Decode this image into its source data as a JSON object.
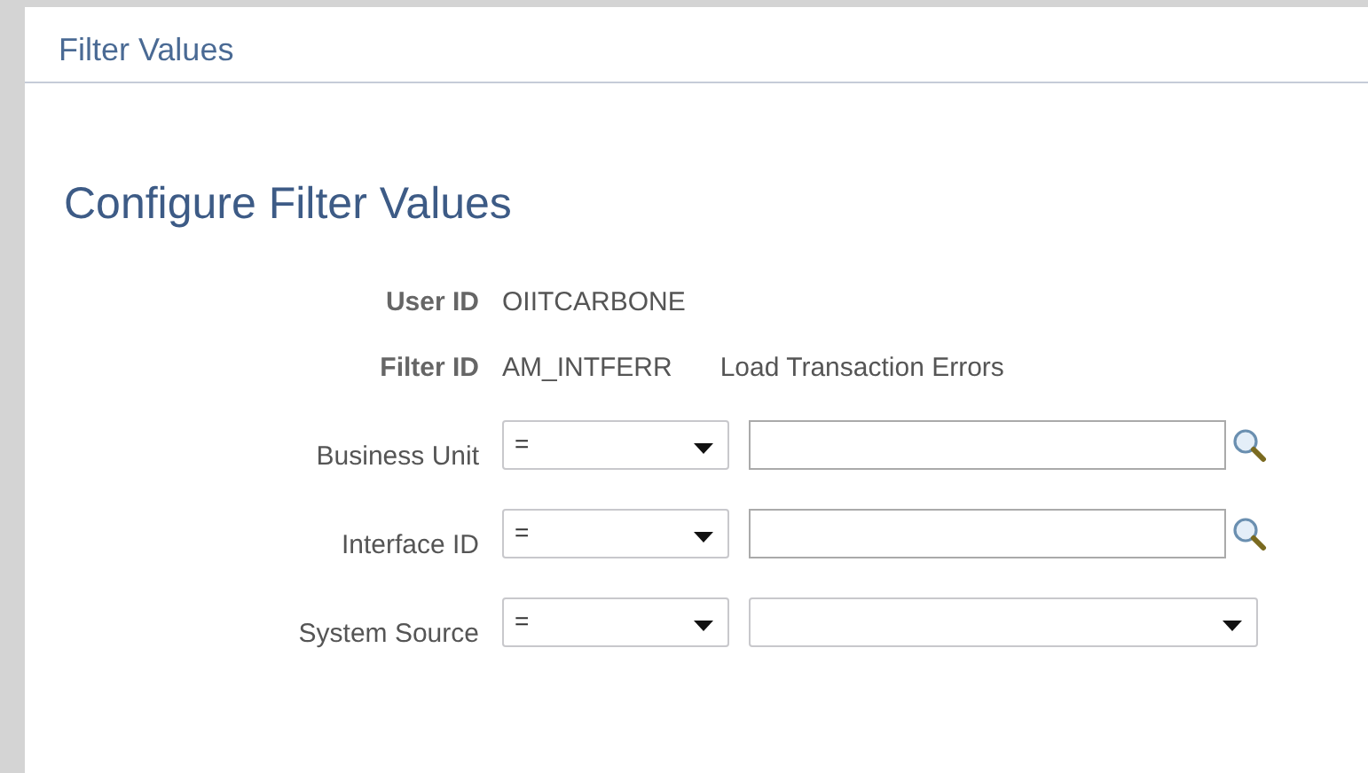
{
  "page": {
    "title": "Filter Values"
  },
  "heading": "Configure Filter Values",
  "info": [
    {
      "label": "User ID",
      "value": "OIITCARBONE"
    },
    {
      "label": "Filter ID",
      "value": "AM_INTFERR",
      "description": "Load Transaction Errors"
    }
  ],
  "filters": [
    {
      "label": "Business Unit",
      "operator": "=",
      "kind": "lookup"
    },
    {
      "label": "Interface ID",
      "operator": "=",
      "kind": "lookup"
    },
    {
      "label": "System Source",
      "operator": "=",
      "kind": "dropdown"
    }
  ]
}
